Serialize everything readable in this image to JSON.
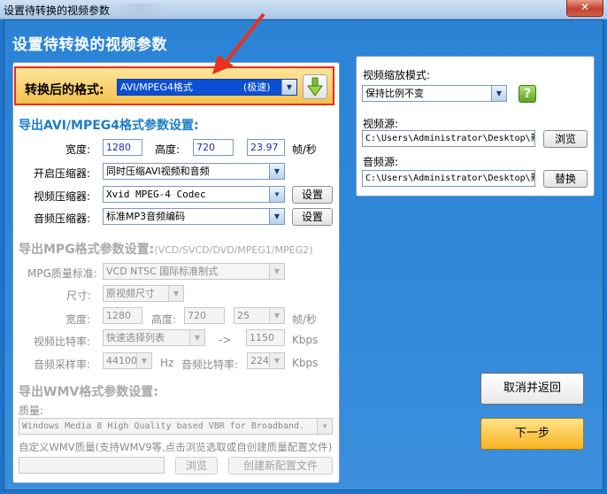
{
  "window": {
    "title": "设置待转换的视频参数",
    "close": "✕"
  },
  "heading": "设置待转换的视频参数",
  "format": {
    "label": "转换后的格式:",
    "value": "AVI/MPEG4格式",
    "hint": "(极速)"
  },
  "avi": {
    "title": "导出AVI/MPEG4格式参数设置:",
    "width_label": "宽度:",
    "width": "1280",
    "height_label": "高度:",
    "height": "720",
    "fps": "23.97",
    "fps_unit": "帧/秒",
    "enable_label": "开启压缩器:",
    "enable_value": "同时压缩AVI视频和音频",
    "vcodec_label": "视频压缩器:",
    "vcodec_value": "Xvid MPEG-4 Codec",
    "acodec_label": "音频压缩器:",
    "acodec_value": "标准MP3音频编码",
    "settings": "设置"
  },
  "mpg": {
    "title": "导出MPG格式参数设置:",
    "title_sub": "(VCD/SVCD/DVD/MPEG1/MPEG2)",
    "quality_label": "MPG质量标准:",
    "quality_value": "VCD  NTSC 国际标准制式",
    "size_label": "尺寸:",
    "size_value": "原视频尺寸",
    "width_label": "宽度:",
    "width": "1280",
    "height_label": "高度:",
    "height": "720",
    "fps": "25",
    "fps_unit": "帧/秒",
    "vbitrate_label": "视频比特率:",
    "vbitrate_value": "快速选择列表",
    "arrow": "->",
    "kbps_value": "1150",
    "kbps": "Kbps",
    "samplerate_label": "音频采样率:",
    "samplerate_value": "44100",
    "hz": "Hz",
    "abitrate_label": "音频比特率:",
    "abitrate_value": "224",
    "kbps2": "Kbps"
  },
  "wmv": {
    "title": "导出WMV格式参数设置:",
    "quality_label": "质量:",
    "quality_value": "Windows Media 8 High Quality based VBR for Broadband.",
    "custom_label": "自定义WMV质量(支持WMV9等,点击浏览选取或自创建质量配置文件)",
    "browse": "浏览",
    "create": "创建新配置文件"
  },
  "right": {
    "scale_label": "视频缩放模式:",
    "scale_value": "保持比例不变",
    "help": "?",
    "video_label": "视频源:",
    "video_path": "C:\\Users\\Administrator\\Desktop\\新",
    "browse": "浏览",
    "audio_label": "音频源:",
    "audio_path": "C:\\Users\\Administrator\\Desktop\\新",
    "replace": "替换"
  },
  "buttons": {
    "cancel": "取消并返回",
    "next": "下一步"
  },
  "colors": {
    "accent": "#1b7ec8",
    "highlight_border": "#ee2b16",
    "arrow": "#e8321e"
  }
}
